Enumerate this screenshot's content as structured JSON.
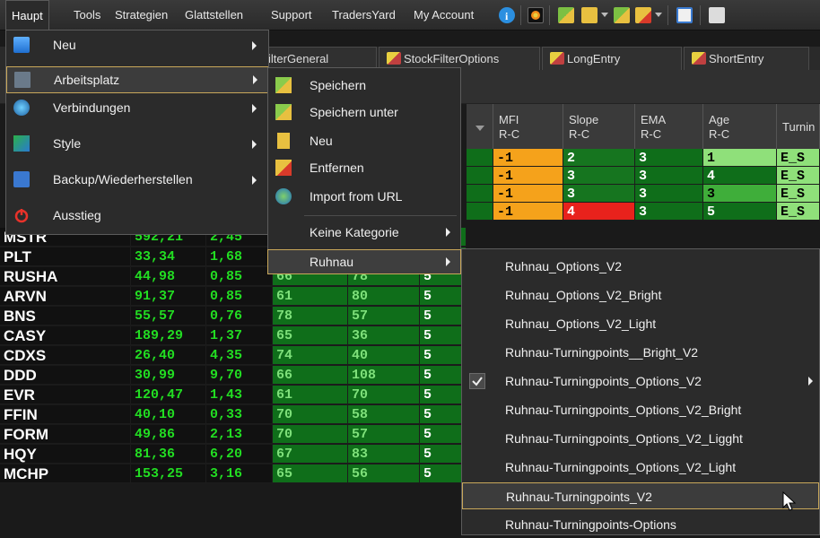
{
  "menubar": {
    "items": [
      "Haupt",
      "Tools",
      "Strategien",
      "Glattstellen",
      "Support",
      "TradersYard",
      "My Account"
    ]
  },
  "tabs": [
    "ilterGeneral",
    "StockFilterOptions",
    "LongEntry",
    "ShortEntry"
  ],
  "grid": {
    "headers": [
      {
        "line1": "MFI",
        "line2": "R-C"
      },
      {
        "line1": "Slope",
        "line2": "R-C"
      },
      {
        "line1": "EMA",
        "line2": "R-C"
      },
      {
        "line1": "Age",
        "line2": "R-C"
      },
      {
        "line1": "Turnin",
        "line2": ""
      }
    ],
    "top_rows": [
      {
        "mfi": "-1",
        "slope": "2",
        "ema": "3",
        "age": "1",
        "turn": "E_S"
      },
      {
        "mfi": "-1",
        "slope": "3",
        "ema": "3",
        "age": "4",
        "turn": "E_S"
      },
      {
        "mfi": "-1",
        "slope": "3",
        "ema": "3",
        "age": "3",
        "turn": "E_S"
      },
      {
        "mfi": "-1",
        "slope": "4",
        "ema": "3",
        "age": "5",
        "turn": "E_S"
      }
    ],
    "rows": [
      {
        "sym": "MSTR",
        "price": "592,21",
        "chg": "2,45",
        "c3": "",
        "c4": "",
        "c5": ""
      },
      {
        "sym": "PLT",
        "price": "33,34",
        "chg": "1,68",
        "c3": "",
        "c4": "",
        "c5": "5"
      },
      {
        "sym": "RUSHA",
        "price": "44,98",
        "chg": "0,85",
        "c3": "66",
        "c4": "78",
        "c5": "5"
      },
      {
        "sym": "ARVN",
        "price": "91,37",
        "chg": "0,85",
        "c3": "61",
        "c4": "80",
        "c5": "5"
      },
      {
        "sym": "BNS",
        "price": "55,57",
        "chg": "0,76",
        "c3": "78",
        "c4": "57",
        "c5": "5"
      },
      {
        "sym": "CASY",
        "price": "189,29",
        "chg": "1,37",
        "c3": "65",
        "c4": "36",
        "c5": "5"
      },
      {
        "sym": "CDXS",
        "price": "26,40",
        "chg": "4,35",
        "c3": "74",
        "c4": "40",
        "c5": "5"
      },
      {
        "sym": "DDD",
        "price": "30,99",
        "chg": "9,70",
        "c3": "66",
        "c4": "108",
        "c5": "5"
      },
      {
        "sym": "EVR",
        "price": "120,47",
        "chg": "1,43",
        "c3": "61",
        "c4": "70",
        "c5": "5"
      },
      {
        "sym": "FFIN",
        "price": "40,10",
        "chg": "0,33",
        "c3": "70",
        "c4": "58",
        "c5": "5"
      },
      {
        "sym": "FORM",
        "price": "49,86",
        "chg": "2,13",
        "c3": "70",
        "c4": "57",
        "c5": "5"
      },
      {
        "sym": "HQY",
        "price": "81,36",
        "chg": "6,20",
        "c3": "67",
        "c4": "83",
        "c5": "5"
      },
      {
        "sym": "MCHP",
        "price": "153,25",
        "chg": "3,16",
        "c3": "65",
        "c4": "56",
        "c5": "5"
      }
    ]
  },
  "menu_haupt": {
    "items": [
      {
        "label": "Neu",
        "submenu": true,
        "icon": "new-doc-icon"
      },
      {
        "label": "Arbeitsplatz",
        "submenu": true,
        "icon": "workspace-icon"
      },
      {
        "label": "Verbindungen",
        "submenu": true,
        "icon": "connections-icon"
      },
      {
        "label": "Style",
        "submenu": true,
        "icon": "style-icon"
      },
      {
        "label": "Backup/Wiederherstellen",
        "submenu": true,
        "icon": "backup-icon"
      },
      {
        "label": "Ausstieg",
        "submenu": false,
        "icon": "exit-icon"
      }
    ]
  },
  "menu_arbeitsplatz": {
    "items": [
      {
        "label": "Speichern",
        "icon": "save-icon"
      },
      {
        "label": "Speichern unter",
        "icon": "save-as-icon"
      },
      {
        "label": "Neu",
        "icon": "new-icon"
      },
      {
        "label": "Entfernen",
        "icon": "remove-icon"
      },
      {
        "label": "Import from URL",
        "icon": "globe-icon"
      },
      {
        "label": "Keine Kategorie",
        "submenu": true
      },
      {
        "label": "Ruhnau",
        "submenu": true
      }
    ]
  },
  "menu_ruhnau": {
    "items": [
      {
        "label": "Ruhnau_Options_V2"
      },
      {
        "label": "Ruhnau_Options_V2_Bright"
      },
      {
        "label": "Ruhnau_Options_V2_Light"
      },
      {
        "label": "Ruhnau-Turningpoints__Bright_V2"
      },
      {
        "label": "Ruhnau-Turningpoints_Options_V2",
        "checked": true,
        "submenu": true
      },
      {
        "label": "Ruhnau-Turningpoints_Options_V2_Bright"
      },
      {
        "label": "Ruhnau-Turningpoints_Options_V2_Ligght"
      },
      {
        "label": "Ruhnau-Turningpoints_Options_V2_Light"
      },
      {
        "label": "Ruhnau-Turningpoints_V2",
        "highlighted": true
      },
      {
        "label": "Ruhnau-Turningpoints-Options"
      }
    ]
  },
  "colors": {
    "price_green": "#22dd22",
    "cell_green_dark": "#0f6e1a",
    "cell_orange": "#f5a21b",
    "cell_red": "#e8221c",
    "menu_bg": "#2b2b2b",
    "highlight_border": "#c9a85a"
  }
}
